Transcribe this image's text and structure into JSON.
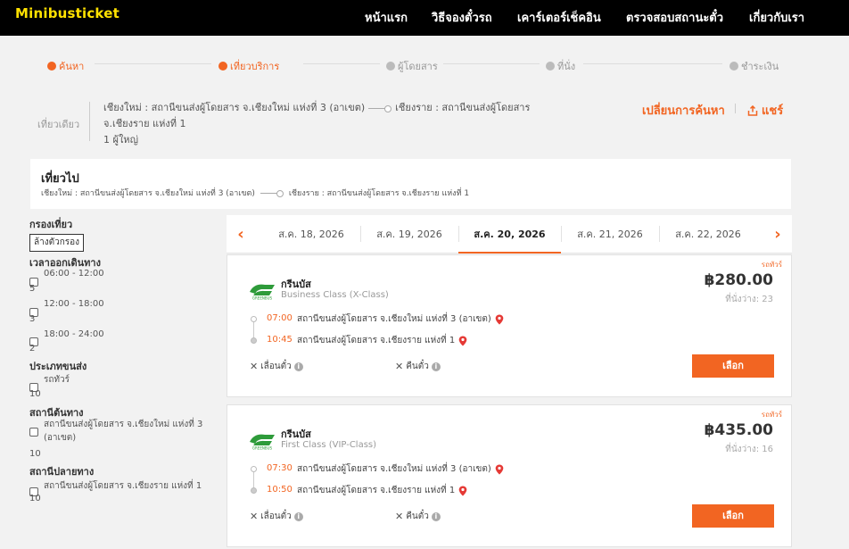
{
  "nav": {
    "logo": "Minibusticket",
    "items": [
      "หน้าแรก",
      "วิธีจองตั๋วรถ",
      "เคาร์เตอร์เช็คอิน",
      "ตรวจสอบสถานะตั๋ว",
      "เกี่ยวกับเรา"
    ]
  },
  "stepper": [
    "ค้นหา",
    "เที่ยวบริการ",
    "ผู้โดยสาร",
    "ที่นั่ง",
    "ชำระเงิน"
  ],
  "summary": {
    "trip_type": "เที่ยวเดียว",
    "origin": "เชียงใหม่ : สถานีขนส่งผู้โดยสาร จ.เชียงใหม่ แห่งที่ 3 (อาเขต)",
    "destination": "เชียงราย : สถานีขนส่งผู้โดยสาร จ.เชียงราย แห่งที่ 1",
    "passengers": "1 ผู้ใหญ่",
    "change_search": "เปลี่ยนการค้นหา",
    "share": "แชร์"
  },
  "trip_header": {
    "title": "เที่ยวไป",
    "origin": "เชียงใหม่ : สถานีขนส่งผู้โดยสาร จ.เชียงใหม่ แห่งที่ 3 (อาเขต)",
    "destination": "เชียงราย : สถานีขนส่งผู้โดยสาร จ.เชียงราย แห่งที่ 1"
  },
  "filters": {
    "title": "กรองเที่ยว",
    "clear": "ล้างตัวกรอง",
    "departure": {
      "label": "เวลาออกเดินทาง",
      "options": [
        {
          "label": "06:00 - 12:00",
          "count": "5"
        },
        {
          "label": "12:00 - 18:00",
          "count": "3"
        },
        {
          "label": "18:00 - 24:00",
          "count": "2"
        }
      ]
    },
    "transport": {
      "label": "ประเภทขนส่ง",
      "options": [
        {
          "label": "รถทัวร์",
          "count": "10"
        }
      ]
    },
    "origin": {
      "label": "สถานีต้นทาง",
      "options": [
        {
          "label": "สถานีขนส่งผู้โดยสาร จ.เชียงใหม่ แห่งที่ 3 (อาเขต)",
          "count": "10"
        }
      ]
    },
    "destination": {
      "label": "สถานีปลายทาง",
      "options": [
        {
          "label": "สถานีขนส่งผู้โดยสาร จ.เชียงราย แห่งที่ 1",
          "count": "10"
        }
      ]
    }
  },
  "dates": [
    "ส.ค. 18, 2026",
    "ส.ค. 19, 2026",
    "ส.ค. 20, 2026",
    "ส.ค. 21, 2026",
    "ส.ค. 22, 2026"
  ],
  "active_date_index": 2,
  "trips": [
    {
      "vehicle": "รถทัวร์",
      "operator": "กรีนบัส",
      "class": "Business Class (X-Class)",
      "price": "฿280.00",
      "seats": "ที่นั่งว่าง: 23",
      "dep_time": "07:00",
      "dep_station": "สถานีขนส่งผู้โดยสาร จ.เชียงใหม่ แห่งที่ 3 (อาเขต)",
      "arr_time": "10:45",
      "arr_station": "สถานีขนส่งผู้โดยสาร จ.เชียงราย แห่งที่ 1",
      "change_policy": "เลื่อนตั๋ว",
      "refund_policy": "คืนตั๋ว",
      "select": "เลือก"
    },
    {
      "vehicle": "รถทัวร์",
      "operator": "กรีนบัส",
      "class": "First Class (VIP-Class)",
      "price": "฿435.00",
      "seats": "ที่นั่งว่าง: 16",
      "dep_time": "07:30",
      "dep_station": "สถานีขนส่งผู้โดยสาร จ.เชียงใหม่ แห่งที่ 3 (อาเขต)",
      "arr_time": "10:50",
      "arr_station": "สถานีขนส่งผู้โดยสาร จ.เชียงราย แห่งที่ 1",
      "change_policy": "เลื่อนตั๋ว",
      "refund_policy": "คืนตั๋ว",
      "select": "เลือก"
    }
  ],
  "colors": {
    "accent": "#f26522",
    "logo": "#ffe100",
    "nav_bg": "#000000",
    "operator_logo": "#2e9b3a"
  },
  "icons": [
    "chevron-left-icon",
    "chevron-right-icon",
    "share-icon",
    "map-pin-icon",
    "info-icon",
    "close-icon",
    "operator-logo-icon"
  ]
}
